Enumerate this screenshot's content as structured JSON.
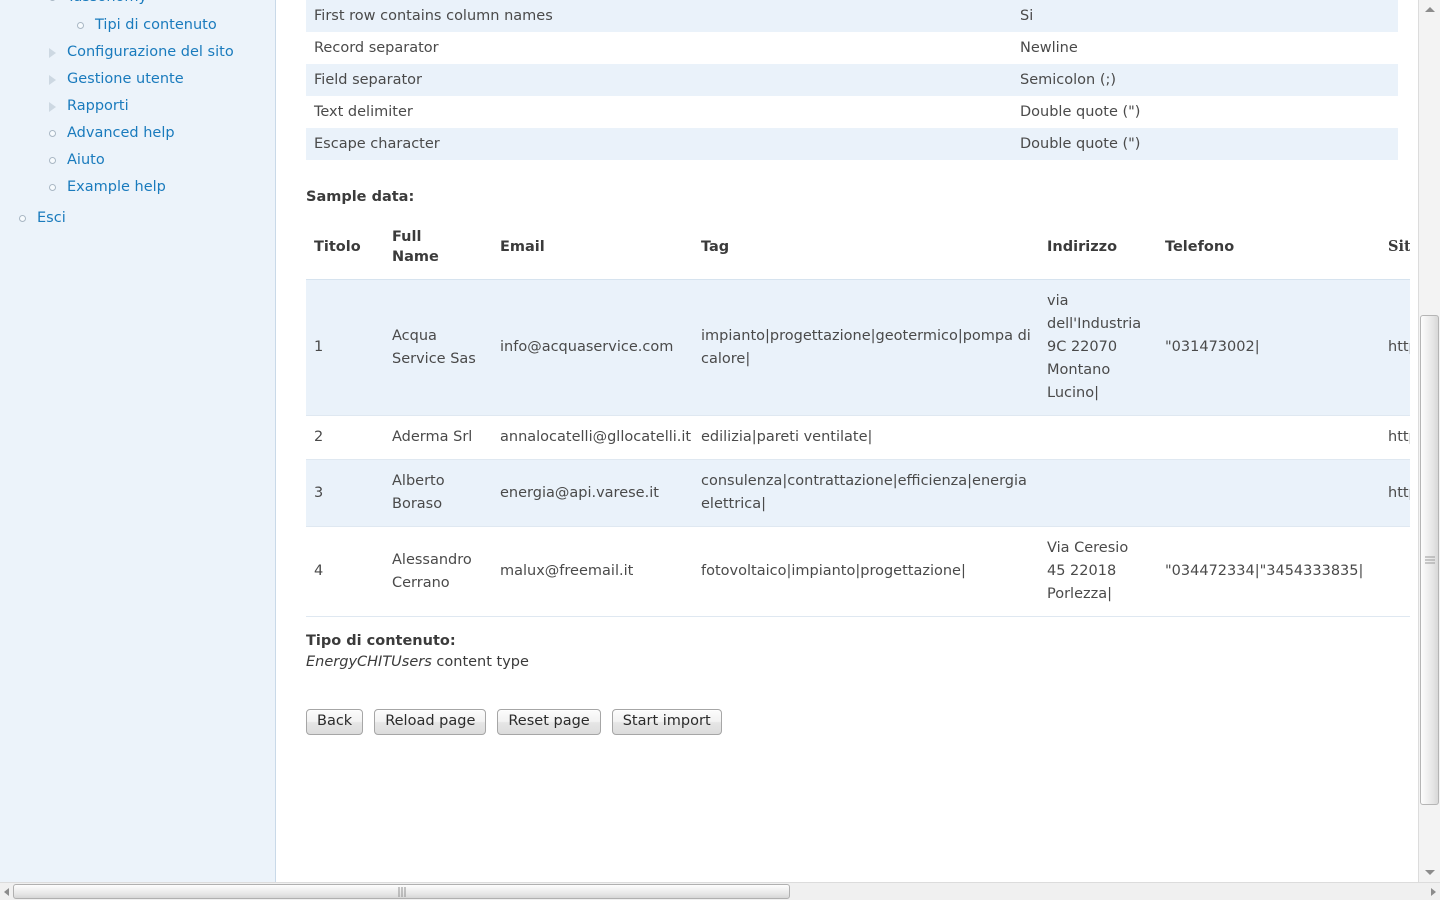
{
  "sidebar": {
    "clipped_top_item": {
      "label": "Tassonomy",
      "marker": "circle-icon",
      "level": 1
    },
    "items": [
      {
        "label": "Tipi di contenuto",
        "marker": "circle-icon",
        "level": 2
      },
      {
        "label": "Configurazione del sito",
        "marker": "triangle-collapsed-icon",
        "level": 1
      },
      {
        "label": "Gestione utente",
        "marker": "triangle-collapsed-icon",
        "level": 1
      },
      {
        "label": "Rapporti",
        "marker": "triangle-collapsed-icon",
        "level": 1
      },
      {
        "label": "Advanced help",
        "marker": "circle-icon",
        "level": 1
      },
      {
        "label": "Aiuto",
        "marker": "circle-icon",
        "level": 1
      },
      {
        "label": "Example help",
        "marker": "circle-icon",
        "level": 1
      },
      {
        "label": "Esci",
        "marker": "circle-icon",
        "level": 0
      }
    ],
    "background_color": "#ecf3fa",
    "link_color": "#1a7bbd"
  },
  "settings": {
    "rows": [
      {
        "key": "First row contains column names",
        "value": "Si"
      },
      {
        "key": "Record separator",
        "value": "Newline"
      },
      {
        "key": "Field separator",
        "value": "Semicolon (;)"
      },
      {
        "key": "Text delimiter",
        "value": "Double quote (\")"
      },
      {
        "key": "Escape character",
        "value": "Double quote (\")"
      }
    ],
    "stripe_color": "#eaf2fa"
  },
  "sample": {
    "heading": "Sample data:",
    "columns": [
      "Titolo",
      "Full Name",
      "Email",
      "Tag",
      "Indirizzo",
      "Telefono",
      "Sito Internet"
    ],
    "columns_split": {
      "titolo": "Titolo",
      "full_name_line1": "Full",
      "full_name_line2": "Name",
      "email": "Email",
      "tag": "Tag",
      "indirizzo": "Indirizzo",
      "telefono": "Telefono",
      "sito_internet": "Sito Internet"
    },
    "rows": [
      {
        "titolo": "1",
        "full_name": "Acqua Service Sas",
        "email": "info@acquaservice.com",
        "tag": "impianto|progettazione|geotermico|pompa di calore|",
        "indirizzo": "via dell'Industria 9C 22070 Montano Lucino|",
        "telefono": "\"031473002|",
        "sito": "http://www.acqua"
      },
      {
        "titolo": "2",
        "full_name": "Aderma Srl",
        "email": "annalocatelli@gllocatelli.it",
        "tag": "edilizia|pareti ventilate|",
        "indirizzo": "",
        "telefono": "",
        "sito": "http://www.aderm"
      },
      {
        "titolo": "3",
        "full_name": "Alberto Boraso",
        "email": "energia@api.varese.it",
        "tag": "consulenza|contrattazione|efficienza|energia elettrica|",
        "indirizzo": "",
        "telefono": "",
        "sito": "http://www.api.va"
      },
      {
        "titolo": "4",
        "full_name": "Alessandro Cerrano",
        "email": "malux@freemail.it",
        "tag": "fotovoltaico|impianto|progettazione|",
        "indirizzo": "Via Ceresio 45 22018 Porlezza|",
        "telefono": "\"034472334|\"3454333835|",
        "sito": ""
      }
    ]
  },
  "content_type": {
    "heading": "Tipo di contenuto:",
    "name": "EnergyCHITUsers",
    "suffix": " content type"
  },
  "buttons": [
    {
      "label": "Back",
      "name": "back-button"
    },
    {
      "label": "Reload page",
      "name": "reload-page-button"
    },
    {
      "label": "Reset page",
      "name": "reset-page-button"
    },
    {
      "label": "Start import",
      "name": "start-import-button"
    }
  ]
}
